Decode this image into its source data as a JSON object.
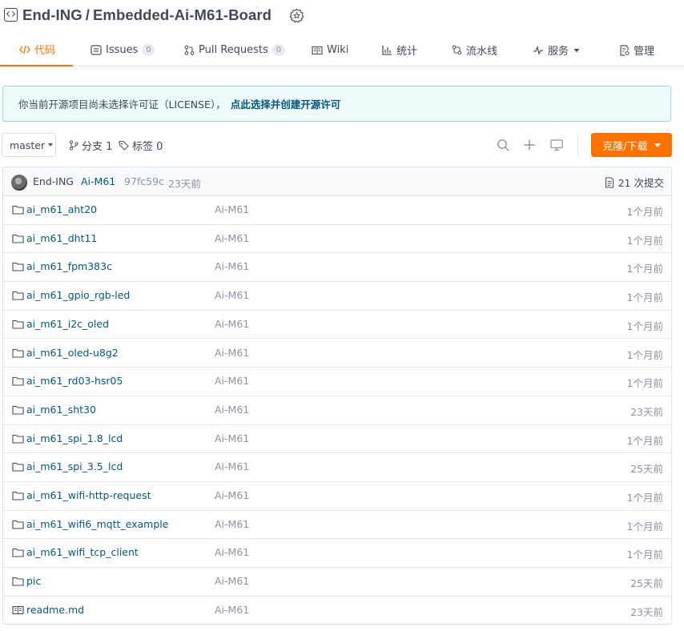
{
  "repo": {
    "owner": "End-ING",
    "separator": "/",
    "name": "Embedded-Ai-M61-Board"
  },
  "tabs": [
    {
      "label": "代码",
      "icon": "code-icon",
      "active": true
    },
    {
      "label": "Issues",
      "icon": "issues-icon",
      "count": "0"
    },
    {
      "label": "Pull Requests",
      "icon": "pull-request-icon",
      "count": "0"
    },
    {
      "label": "Wiki",
      "icon": "book-icon"
    },
    {
      "label": "统计",
      "icon": "bar-chart-icon"
    },
    {
      "label": "流水线",
      "icon": "pipeline-icon"
    },
    {
      "label": "服务",
      "icon": "pulse-icon"
    },
    {
      "label": "管理",
      "icon": "manage-icon"
    }
  ],
  "license": {
    "text": "你当前开源项目尚未选择许可证（LICENSE），",
    "link": "点此选择并创建开源许可"
  },
  "toolbar": {
    "branch": "master",
    "branches_label": "分支 1",
    "tags_label": "标签 0",
    "clone_label": "克隆/下载"
  },
  "commit": {
    "author": "End-ING",
    "message": "Ai-M61",
    "hash": "97fc59c",
    "time": "23天前",
    "count_label": "21 次提交"
  },
  "files": [
    {
      "type": "folder",
      "name": "ai_m61_aht20",
      "message": "Ai-M61",
      "time": "1个月前"
    },
    {
      "type": "folder",
      "name": "ai_m61_dht11",
      "message": "Ai-M61",
      "time": "1个月前"
    },
    {
      "type": "folder",
      "name": "ai_m61_fpm383c",
      "message": "Ai-M61",
      "time": "1个月前"
    },
    {
      "type": "folder",
      "name": "ai_m61_gpio_rgb-led",
      "message": "Ai-M61",
      "time": "1个月前"
    },
    {
      "type": "folder",
      "name": "ai_m61_i2c_oled",
      "message": "Ai-M61",
      "time": "1个月前"
    },
    {
      "type": "folder",
      "name": "ai_m61_oled-u8g2",
      "message": "Ai-M61",
      "time": "1个月前"
    },
    {
      "type": "folder",
      "name": "ai_m61_rd03-hsr05",
      "message": "Ai-M61",
      "time": "1个月前"
    },
    {
      "type": "folder",
      "name": "ai_m61_sht30",
      "message": "Ai-M61",
      "time": "23天前"
    },
    {
      "type": "folder",
      "name": "ai_m61_spi_1.8_lcd",
      "message": "Ai-M61",
      "time": "1个月前"
    },
    {
      "type": "folder",
      "name": "ai_m61_spi_3.5_lcd",
      "message": "Ai-M61",
      "time": "25天前"
    },
    {
      "type": "folder",
      "name": "ai_m61_wifi-http-request",
      "message": "Ai-M61",
      "time": "1个月前"
    },
    {
      "type": "folder",
      "name": "ai_m61_wifi6_mqtt_example",
      "message": "Ai-M61",
      "time": "1个月前"
    },
    {
      "type": "folder",
      "name": "ai_m61_wifi_tcp_client",
      "message": "Ai-M61",
      "time": "1个月前"
    },
    {
      "type": "folder",
      "name": "pic",
      "message": "Ai-M61",
      "time": "25天前"
    },
    {
      "type": "readme",
      "name": "readme.md",
      "message": "Ai-M61",
      "time": "23天前"
    }
  ],
  "colors": {
    "accent": "#fe7300",
    "link": "#005980",
    "text": "#40485b",
    "muted": "#8c92a4"
  }
}
